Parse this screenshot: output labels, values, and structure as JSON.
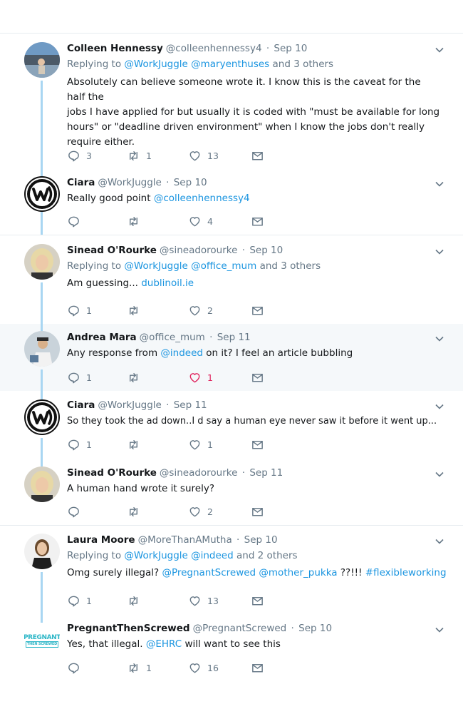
{
  "tweets": [
    {
      "name": "Colleen Hennessy",
      "handle": "@colleenhennessy4",
      "date": "Sep 10",
      "avatar_icon": "photo-avatar-icon",
      "replying_prefix": "Replying to",
      "replying_mentions": "@WorkJuggle @maryenthuses",
      "replying_suffix": "and 3 others",
      "text_lines": [
        "Absolutely can believe someone wrote it. I know this is the caveat for the half the",
        "jobs I have applied for but usually it is coded with \"must be available for long",
        "hours\" or \"deadline driven environment\" when I know the jobs don't really",
        "require either."
      ],
      "replies": "3",
      "retweets": "1",
      "likes": "13"
    },
    {
      "name": "Ciara",
      "handle": "@WorkJuggle",
      "date": "Sep 10",
      "avatar_icon": "workjuggle-logo-icon",
      "text_plain": "Really good point",
      "text_mention": "@colleenhennessy4",
      "replies": "",
      "retweets": "",
      "likes": "4"
    },
    {
      "name": "Sinead O'Rourke",
      "handle": "@sineadorourke",
      "date": "Sep 10",
      "avatar_icon": "photo-avatar-icon",
      "replying_prefix": "Replying to",
      "replying_mentions": "@WorkJuggle @office_mum",
      "replying_suffix": "and 3 others",
      "text_plain": "Am guessing...",
      "text_mention": "dublinoil.ie",
      "replies": "1",
      "retweets": "",
      "likes": "2"
    },
    {
      "name": "Andrea Mara",
      "handle": "@office_mum",
      "date": "Sep 11",
      "avatar_icon": "photo-avatar-icon",
      "text_a": "Any response from",
      "text_mention": "@indeed",
      "text_b": "on it? I feel an article bubbling",
      "replies": "1",
      "retweets": "",
      "likes": "1",
      "liked_color": "#e0245e"
    },
    {
      "name": "Ciara",
      "handle": "@WorkJuggle",
      "date": "Sep 11",
      "avatar_icon": "workjuggle-logo-icon",
      "text_plain": "So they took the ad down..I d say a human eye never saw it before it went up...",
      "replies": "1",
      "retweets": "",
      "likes": "1"
    },
    {
      "name": "Sinead O'Rourke",
      "handle": "@sineadorourke",
      "date": "Sep 11",
      "avatar_icon": "photo-avatar-icon",
      "text_plain": "A human hand wrote it surely?",
      "replies": "",
      "retweets": "",
      "likes": "2"
    },
    {
      "name": "Laura Moore",
      "handle": "@MoreThanAMutha",
      "date": "Sep 10",
      "avatar_icon": "photo-avatar-icon",
      "replying_prefix": "Replying to",
      "replying_mentions": "@WorkJuggle @indeed",
      "replying_suffix": "and 2 others",
      "text_plain": "Omg surely illegal?",
      "text_mention": "@PregnantScrewed @mother_pukka",
      "text_b": "??!!!",
      "text_hashtag": "#flexibleworking",
      "replies": "1",
      "retweets": "",
      "likes": "13"
    },
    {
      "name": "PregnantThenScrewed",
      "handle": "@PregnantScrewed",
      "date": "Sep 10",
      "avatar_icon": "pregnant-then-screwed-logo-icon",
      "logo_line1": "PREGNANT",
      "logo_line2": "THEN SCREWED",
      "text_a": "Yes, that illegal.",
      "text_mention": "@EHRC",
      "text_b": "will want to see this",
      "replies": "",
      "retweets": "1",
      "likes": "16"
    }
  ],
  "colors": {
    "link": "#1b95e0",
    "muted": "#657786",
    "thread": "#a9d6f2",
    "highlight_bg": "#f5f8fa"
  }
}
